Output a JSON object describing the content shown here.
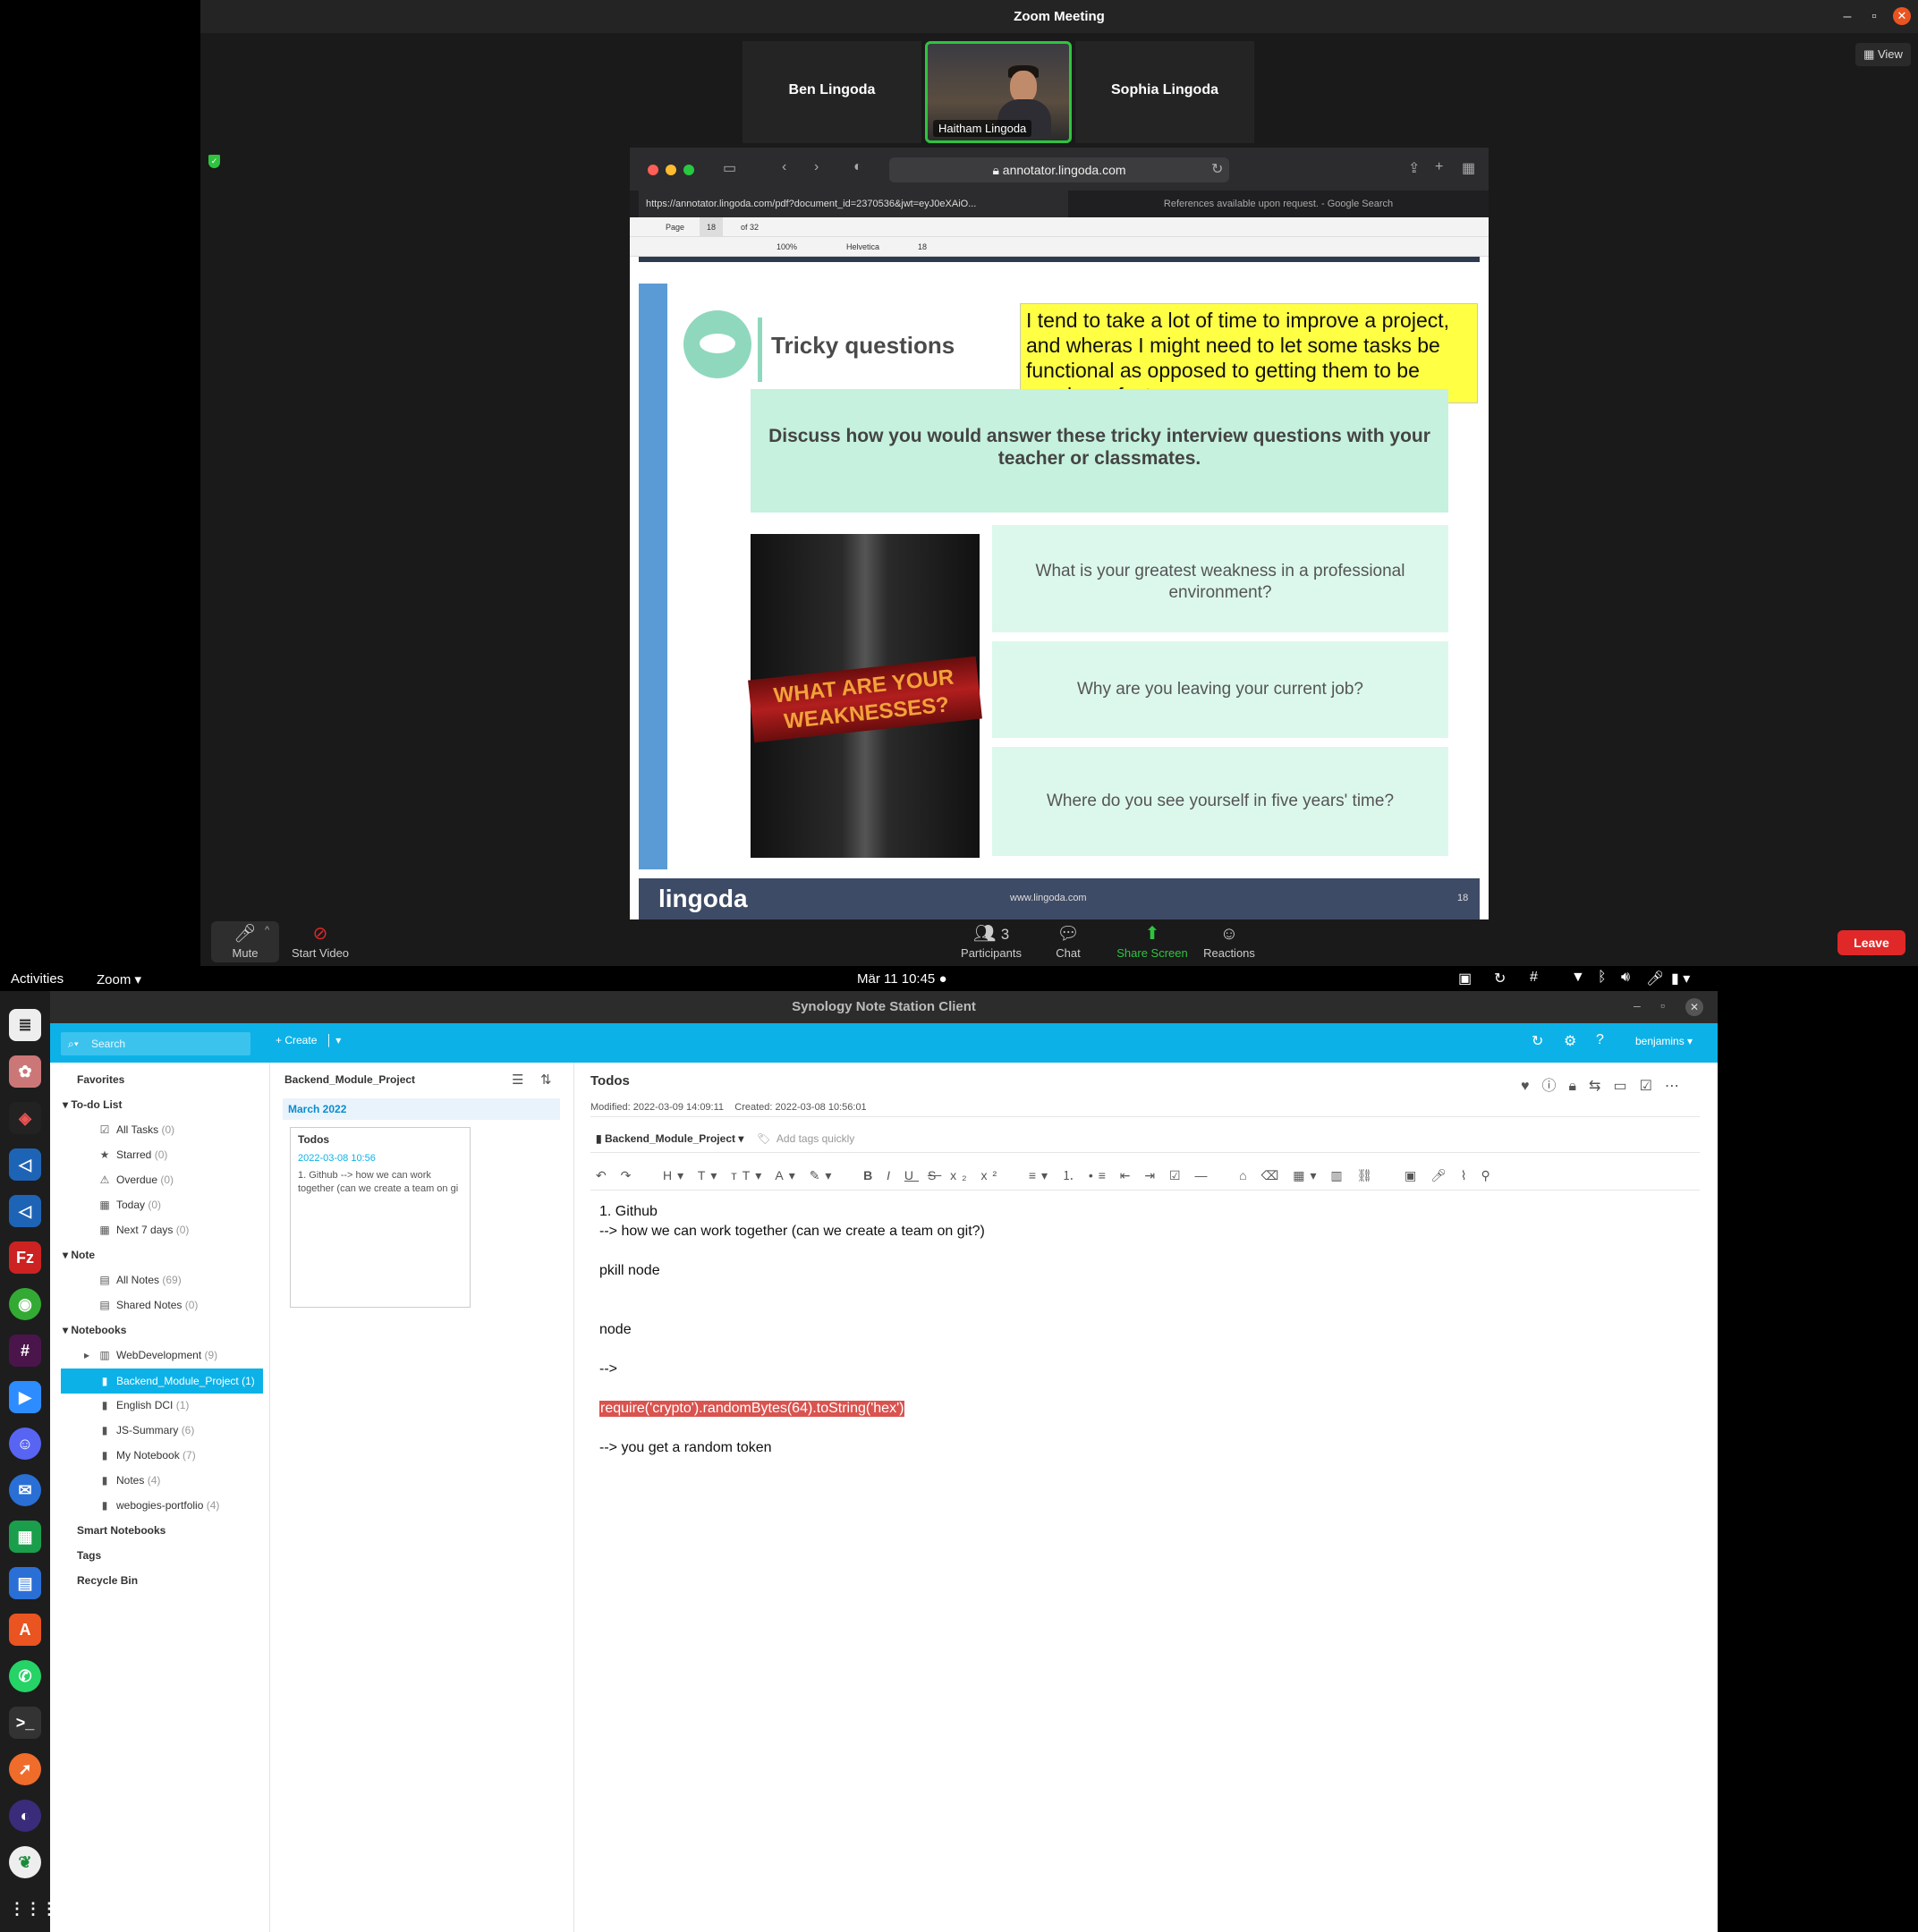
{
  "zoom": {
    "title": "Zoom Meeting",
    "view_label": "View",
    "participants": {
      "ben": "Ben Lingoda",
      "haitham": "Haitham Lingoda",
      "sophia": "Sophia Lingoda"
    },
    "controls": {
      "mute": "Mute",
      "start_video": "Start Video",
      "participants": "Participants",
      "participants_count": "3",
      "chat": "Chat",
      "share_screen": "Share Screen",
      "reactions": "Reactions",
      "leave": "Leave"
    }
  },
  "shared_screen": {
    "browser": {
      "address": "annotator.lingoda.com",
      "tab1": "https://annotator.lingoda.com/pdf?document_id=2370536&jwt=eyJ0eXAiO...",
      "tab2": "References available upon request. - Google Search"
    },
    "pdf_toolbar": {
      "page_label": "Page",
      "page_number": "18",
      "page_total": "of 32",
      "zoom": "100%",
      "font": "Helvetica",
      "font_size": "18"
    },
    "slide": {
      "title": "Tricky questions",
      "annotation": "I tend to take a lot of time to improve a project, and wheras I might need to let some tasks be functional as opposed to getting them to be nearly perfect.",
      "instruction": "Discuss how you would answer these tricky interview questions with your teacher or classmates.",
      "image_text": "WHAT ARE YOUR WEAKNESSES?",
      "questions": [
        "What is your greatest weakness in a professional environment?",
        "Why are you leaving your current job?",
        "Where do you see yourself in five years' time?"
      ],
      "footer_logo": "lingoda",
      "footer_url": "www.lingoda.com",
      "footer_page": "18"
    }
  },
  "gnome": {
    "activities": "Activities",
    "app_menu": "Zoom",
    "clock": "Mär 11  10:45"
  },
  "note_station": {
    "window_title": "Synology Note Station Client",
    "search_placeholder": "Search",
    "create_label": "Create",
    "user": "benjamins",
    "sidebar": {
      "favorites": "Favorites",
      "todo_header": "To-do List",
      "todo_items": [
        {
          "label": "All Tasks",
          "count": "(0)"
        },
        {
          "label": "Starred",
          "count": "(0)"
        },
        {
          "label": "Overdue",
          "count": "(0)"
        },
        {
          "label": "Today",
          "count": "(0)"
        },
        {
          "label": "Next 7 days",
          "count": "(0)"
        }
      ],
      "note_header": "Note",
      "note_items": [
        {
          "label": "All Notes",
          "count": "(69)"
        },
        {
          "label": "Shared Notes",
          "count": "(0)"
        }
      ],
      "notebooks_header": "Notebooks",
      "notebooks": [
        {
          "label": "WebDevelopment",
          "count": "(9)"
        },
        {
          "label": "Backend_Module_Project",
          "count": "(1)"
        },
        {
          "label": "English DCI",
          "count": "(1)"
        },
        {
          "label": "JS-Summary",
          "count": "(6)"
        },
        {
          "label": "My Notebook",
          "count": "(7)"
        },
        {
          "label": "Notes",
          "count": "(4)"
        },
        {
          "label": "webogies-portfolio",
          "count": "(4)"
        }
      ],
      "smart_notebooks": "Smart Notebooks",
      "tags": "Tags",
      "recycle_bin": "Recycle Bin"
    },
    "list": {
      "notebook": "Backend_Module_Project",
      "month": "March 2022",
      "card": {
        "title": "Todos",
        "date": "2022-03-08 10:56",
        "preview": "1. Github --> how we can work together (can we create a team on gi"
      }
    },
    "editor": {
      "title": "Todos",
      "modified_label": "Modified:",
      "modified": "2022-03-09 14:09:11",
      "created_label": "Created:",
      "created": "2022-03-08 10:56:01",
      "notebook": "Backend_Module_Project",
      "tags_placeholder": "Add tags quickly",
      "lines": {
        "l1": "1. Github",
        "l2": "--> how we can work together (can we create a team on git?)",
        "l3": "pkill node",
        "l4": "node",
        "l5": "-->",
        "l6": "require('crypto').randomBytes(64).toString('hex')",
        "l7": "--> you get a random token"
      }
    }
  }
}
